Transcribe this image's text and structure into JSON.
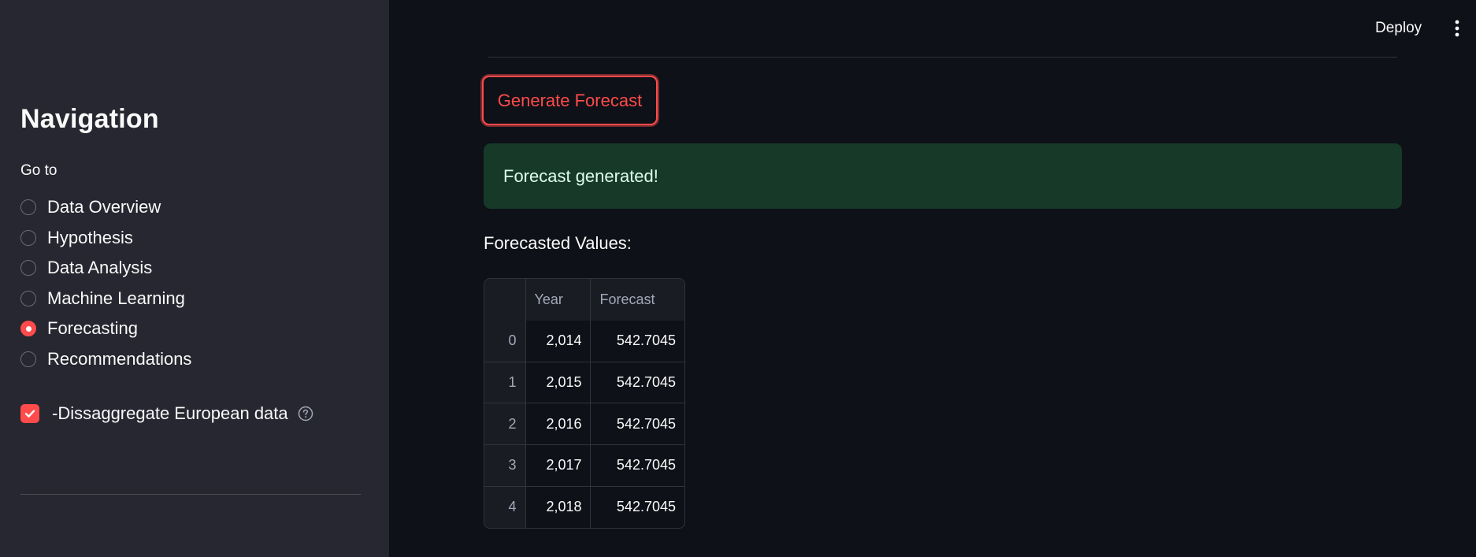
{
  "header": {
    "deploy_label": "Deploy",
    "menu_icon": "vertical-dots-icon"
  },
  "sidebar": {
    "title": "Navigation",
    "radio_group_label": "Go to",
    "items": [
      {
        "label": "Data Overview",
        "selected": false
      },
      {
        "label": "Hypothesis",
        "selected": false
      },
      {
        "label": "Data Analysis",
        "selected": false
      },
      {
        "label": "Machine Learning",
        "selected": false
      },
      {
        "label": "Forecasting",
        "selected": true
      },
      {
        "label": "Recommendations",
        "selected": false
      }
    ],
    "checkbox": {
      "label": "-Dissaggregate European data",
      "checked": true,
      "help_icon": "question-circle-icon"
    }
  },
  "main": {
    "generate_button_label": "Generate Forecast",
    "success_message": "Forecast generated!",
    "table_title": "Forecasted Values:",
    "table": {
      "columns": [
        "",
        "Year",
        "Forecast"
      ],
      "rows": [
        {
          "index": "0",
          "year": "2,014",
          "forecast": "542.7045"
        },
        {
          "index": "1",
          "year": "2,015",
          "forecast": "542.7045"
        },
        {
          "index": "2",
          "year": "2,016",
          "forecast": "542.7045"
        },
        {
          "index": "3",
          "year": "2,017",
          "forecast": "542.7045"
        },
        {
          "index": "4",
          "year": "2,018",
          "forecast": "542.7045"
        }
      ]
    }
  },
  "colors": {
    "accent": "#ff4b4b",
    "sidebar_bg": "#262730",
    "main_bg": "#0e1117",
    "success_bg": "#173928"
  }
}
